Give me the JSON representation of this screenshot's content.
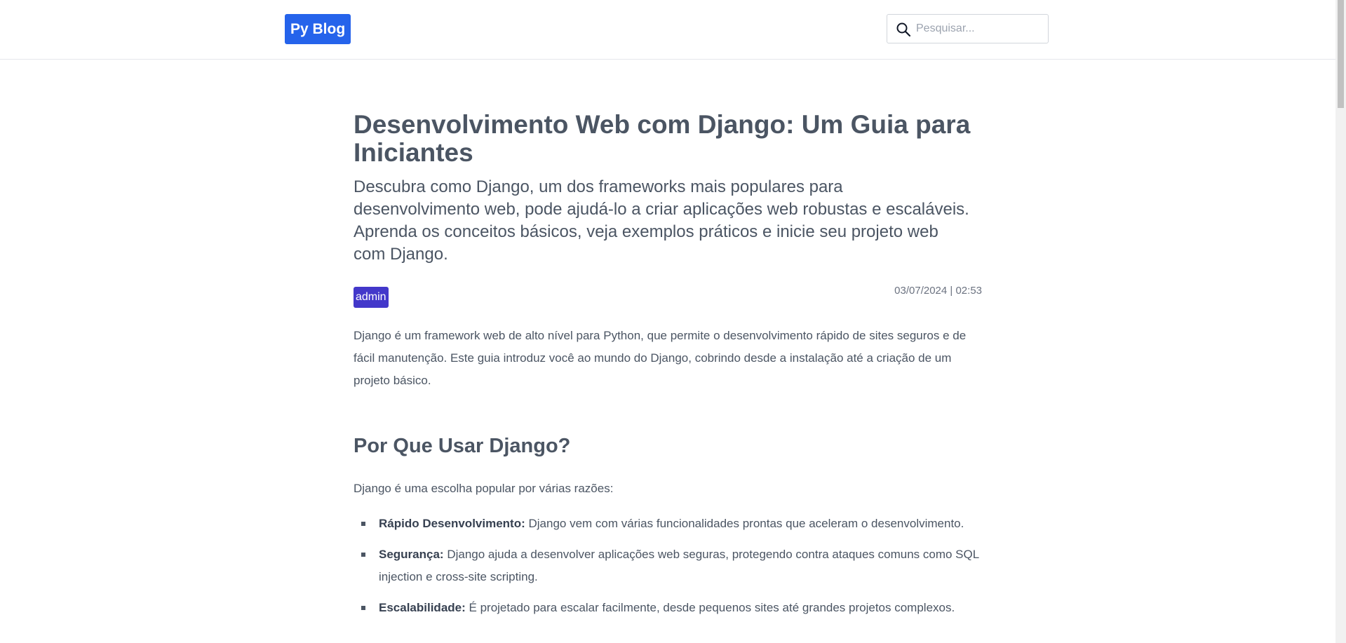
{
  "header": {
    "logo_text": "Py Blog",
    "search_placeholder": "Pesquisar..."
  },
  "article": {
    "title": "Desenvolvimento Web com Django: Um Guia para Iniciantes",
    "subtitle": "Descubra como Django, um dos frameworks mais populares para desenvolvimento web, pode ajudá-lo a criar aplicações web robustas e escaláveis. Aprenda os conceitos básicos, veja exemplos práticos e inicie seu projeto web com Django.",
    "author": "admin",
    "date": "03/07/2024 | 02:53",
    "intro": "Django é um framework web de alto nível para Python, que permite o desenvolvimento rápido de sites seguros e de fácil manutenção. Este guia introduz você ao mundo do Django, cobrindo desde a instalação até a criação de um projeto básico.",
    "section": {
      "title": "Por Que Usar Django?",
      "paragraph": "Django é uma escolha popular por várias razões:",
      "items": [
        {
          "label": "Rápido Desenvolvimento:",
          "text": "Django vem com várias funcionalidades prontas que aceleram o desenvolvimento."
        },
        {
          "label": "Segurança:",
          "text": "Django ajuda a desenvolver aplicações web seguras, protegendo contra ataques comuns como SQL injection e cross-site scripting."
        },
        {
          "label": "Escalabilidade:",
          "text": "É projetado para escalar facilmente, desde pequenos sites até grandes projetos complexos."
        }
      ]
    }
  },
  "colors": {
    "brand": "#2563eb",
    "author_badge": "#4338ca",
    "text": "#4b5563"
  }
}
